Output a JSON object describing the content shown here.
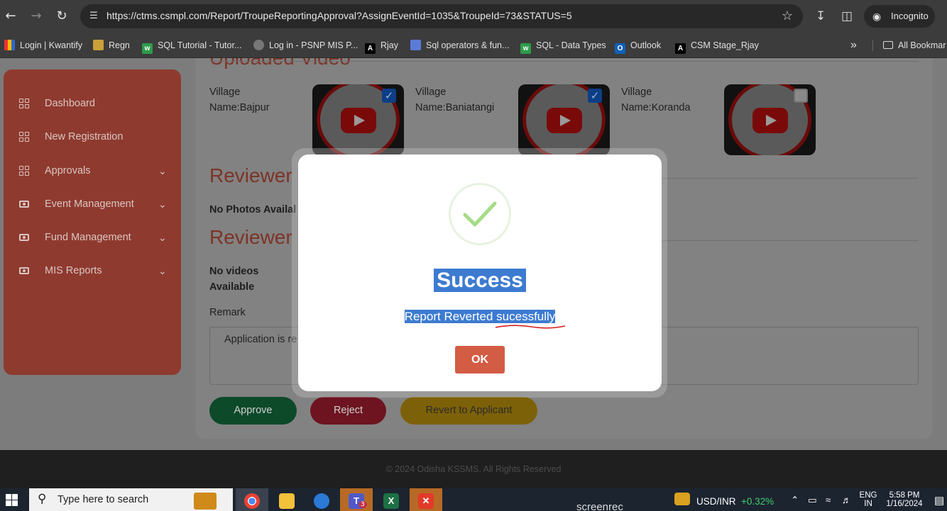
{
  "browser": {
    "url": "https://ctms.csmpl.com/Report/TroupeReportingApproval?AssignEventId=1035&TroupeId=73&STATUS=5",
    "profile_label": "Incognito",
    "bookmarks": [
      {
        "label": "Login | Kwantify",
        "icon": "kwantify-icon"
      },
      {
        "label": "Regn",
        "icon": "regn-icon"
      },
      {
        "label": "SQL Tutorial - Tutor...",
        "icon": "sql-tutorial-icon"
      },
      {
        "label": "Log in - PSNP MIS P...",
        "icon": "globe-icon"
      },
      {
        "label": "Rjay",
        "icon": "rjay-icon"
      },
      {
        "label": "Sql operators & fun...",
        "icon": "sql-operators-icon"
      },
      {
        "label": "SQL - Data Types",
        "icon": "sql-datatypes-icon"
      },
      {
        "label": "Outlook",
        "icon": "outlook-icon"
      },
      {
        "label": "CSM Stage_Rjay",
        "icon": "csm-stage-icon"
      }
    ],
    "all_bookmarks_label": "All Bookmar"
  },
  "sidebar": {
    "items": [
      {
        "label": "Dashboard",
        "icon": "grid-icon",
        "expandable": false
      },
      {
        "label": "New Registration",
        "icon": "grid-icon",
        "expandable": false
      },
      {
        "label": "Approvals",
        "icon": "grid-icon",
        "expandable": true
      },
      {
        "label": "Event Management",
        "icon": "money-icon",
        "expandable": true
      },
      {
        "label": "Fund Management",
        "icon": "money-icon",
        "expandable": true
      },
      {
        "label": "MIS Reports",
        "icon": "money-icon",
        "expandable": true
      }
    ]
  },
  "main": {
    "uploaded_video_heading": "Uploaded Video",
    "videos": [
      {
        "label_line1": "Village",
        "label_line2": "Name:Bajpur",
        "checked": true
      },
      {
        "label_line1": "Village",
        "label_line2": "Name:Baniatangi",
        "checked": true
      },
      {
        "label_line1": "Village",
        "label_line2": "Name:Koranda",
        "checked": false
      }
    ],
    "reviewer_heading_1": "Reviewer",
    "no_photos_text": "No Photos Availal",
    "reviewer_heading_2": "Reviewer",
    "no_videos_line1": "No videos",
    "no_videos_line2": "Available",
    "remark_label": "Remark",
    "remark_value": "Application is re",
    "buttons": {
      "approve": "Approve",
      "reject": "Reject",
      "revert": "Revert to Applicant"
    },
    "button_colors": {
      "approve": "#0c4a2a",
      "reject": "#6d1420",
      "revert": "#7d6108"
    }
  },
  "footer": {
    "text": "© 2024 Odisha KSSMS. All Rights Reserved"
  },
  "modal": {
    "title": "Success",
    "message_part1": "Report Reverted ",
    "message_part2": "sucessfully",
    "ok_label": "OK",
    "ok_color": "#d25c44",
    "check_color": "#a5dc86"
  },
  "taskbar": {
    "search_placeholder": "Type here to search",
    "teams_badge": "3",
    "currency_label": "USD/INR",
    "currency_change": "+0.32%",
    "language_line1": "ENG",
    "language_line2": "IN",
    "time": "5:58 PM",
    "date": "1/16/2024",
    "watermark": "screenrec"
  }
}
